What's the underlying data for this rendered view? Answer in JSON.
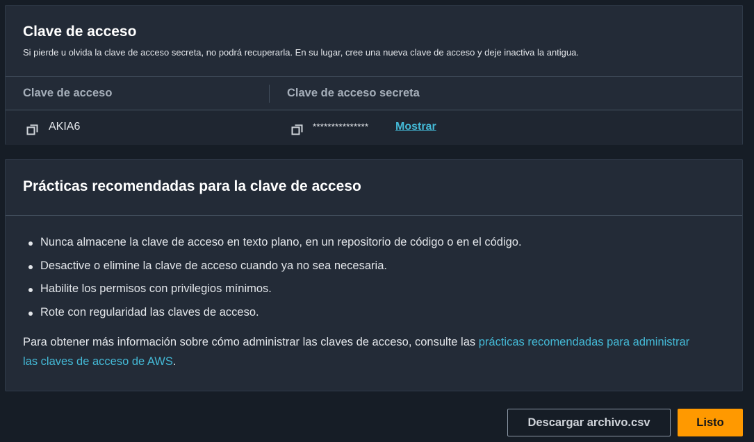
{
  "keys_panel": {
    "title": "Clave de acceso",
    "description": "Si pierde u olvida la clave de acceso secreta, no podrá recuperarla. En su lugar, cree una nueva clave de acceso y deje inactiva la antigua.",
    "columns": [
      "Clave de acceso",
      "Clave de acceso secreta"
    ],
    "access_key_value": "AKIA6",
    "secret_key_mask": "***************",
    "show_label": "Mostrar",
    "icons": {
      "copy": "copy-icon"
    }
  },
  "best_practices": {
    "title": "Prácticas recomendadas para la clave de acceso",
    "items": [
      "Nunca almacene la clave de acceso en texto plano, en un repositorio de código o en el código.",
      "Desactive o elimine la clave de acceso cuando ya no sea necesaria.",
      "Habilite los permisos con privilegios mínimos.",
      "Rote con regularidad las claves de acceso."
    ],
    "more_info_prefix": "Para obtener más información sobre cómo administrar las claves de acceso, consulte las ",
    "more_info_link": "prácticas recomendadas para administrar las claves de acceso de AWS",
    "more_info_suffix": "."
  },
  "actions": {
    "download_label": "Descargar archivo.csv",
    "done_label": "Listo"
  },
  "colors": {
    "background": "#161d26",
    "panel": "#232b37",
    "link": "#44b9d6",
    "primary": "#ff9900"
  }
}
